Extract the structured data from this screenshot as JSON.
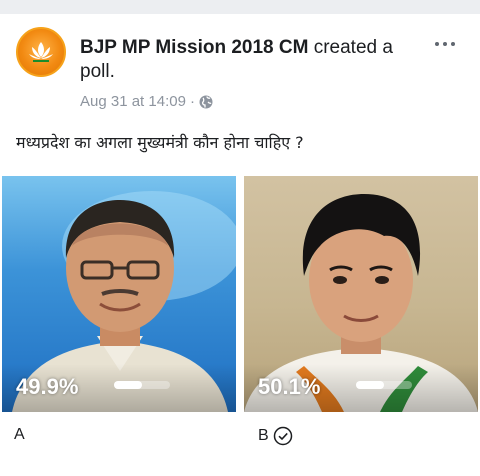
{
  "post": {
    "author": "BJP MP Mission 2018 CM",
    "action": "created a poll.",
    "timestamp": "Aug 31 at 14:09",
    "separator": "·",
    "privacy_icon": "globe-icon",
    "more_icon": "more-options-icon",
    "avatar_icon": "bjp-lotus-logo"
  },
  "poll": {
    "question": "मध्यप्रदेश का अगला मुख्यमंत्री कौन होना चाहिए ?",
    "options": [
      {
        "label": "A",
        "percent_text": "49.9%",
        "percent": 49.9,
        "selected": false
      },
      {
        "label": "B",
        "percent_text": "50.1%",
        "percent": 50.1,
        "selected": true,
        "selected_icon": "check-circle-icon"
      }
    ]
  },
  "colors": {
    "avatar_orange": "#f28a12",
    "text_primary": "#1c1e21",
    "text_secondary": "#8d949e"
  }
}
